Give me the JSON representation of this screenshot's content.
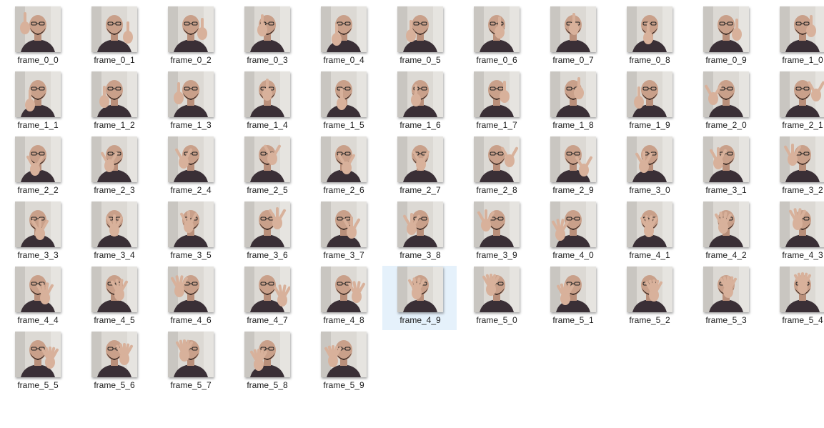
{
  "window": {
    "view": "large-icons",
    "selected_index": 49
  },
  "files": [
    {
      "name": "frame_0_0",
      "icon": "image-thumbnail-icon"
    },
    {
      "name": "frame_0_1",
      "icon": "image-thumbnail-icon"
    },
    {
      "name": "frame_0_2",
      "icon": "image-thumbnail-icon"
    },
    {
      "name": "frame_0_3",
      "icon": "image-thumbnail-icon"
    },
    {
      "name": "frame_0_4",
      "icon": "image-thumbnail-icon"
    },
    {
      "name": "frame_0_5",
      "icon": "image-thumbnail-icon"
    },
    {
      "name": "frame_0_6",
      "icon": "image-thumbnail-icon"
    },
    {
      "name": "frame_0_7",
      "icon": "image-thumbnail-icon"
    },
    {
      "name": "frame_0_8",
      "icon": "image-thumbnail-icon"
    },
    {
      "name": "frame_0_9",
      "icon": "image-thumbnail-icon"
    },
    {
      "name": "frame_1_0",
      "icon": "image-thumbnail-icon"
    },
    {
      "name": "frame_1_1",
      "icon": "image-thumbnail-icon"
    },
    {
      "name": "frame_1_2",
      "icon": "image-thumbnail-icon"
    },
    {
      "name": "frame_1_3",
      "icon": "image-thumbnail-icon"
    },
    {
      "name": "frame_1_4",
      "icon": "image-thumbnail-icon"
    },
    {
      "name": "frame_1_5",
      "icon": "image-thumbnail-icon"
    },
    {
      "name": "frame_1_6",
      "icon": "image-thumbnail-icon"
    },
    {
      "name": "frame_1_7",
      "icon": "image-thumbnail-icon"
    },
    {
      "name": "frame_1_8",
      "icon": "image-thumbnail-icon"
    },
    {
      "name": "frame_1_9",
      "icon": "image-thumbnail-icon"
    },
    {
      "name": "frame_2_0",
      "icon": "image-thumbnail-icon"
    },
    {
      "name": "frame_2_1",
      "icon": "image-thumbnail-icon"
    },
    {
      "name": "frame_2_2",
      "icon": "image-thumbnail-icon"
    },
    {
      "name": "frame_2_3",
      "icon": "image-thumbnail-icon"
    },
    {
      "name": "frame_2_4",
      "icon": "image-thumbnail-icon"
    },
    {
      "name": "frame_2_5",
      "icon": "image-thumbnail-icon"
    },
    {
      "name": "frame_2_6",
      "icon": "image-thumbnail-icon"
    },
    {
      "name": "frame_2_7",
      "icon": "image-thumbnail-icon"
    },
    {
      "name": "frame_2_8",
      "icon": "image-thumbnail-icon"
    },
    {
      "name": "frame_2_9",
      "icon": "image-thumbnail-icon"
    },
    {
      "name": "frame_3_0",
      "icon": "image-thumbnail-icon"
    },
    {
      "name": "frame_3_1",
      "icon": "image-thumbnail-icon"
    },
    {
      "name": "frame_3_2",
      "icon": "image-thumbnail-icon"
    },
    {
      "name": "frame_3_3",
      "icon": "image-thumbnail-icon"
    },
    {
      "name": "frame_3_4",
      "icon": "image-thumbnail-icon"
    },
    {
      "name": "frame_3_5",
      "icon": "image-thumbnail-icon"
    },
    {
      "name": "frame_3_6",
      "icon": "image-thumbnail-icon"
    },
    {
      "name": "frame_3_7",
      "icon": "image-thumbnail-icon"
    },
    {
      "name": "frame_3_8",
      "icon": "image-thumbnail-icon"
    },
    {
      "name": "frame_3_9",
      "icon": "image-thumbnail-icon"
    },
    {
      "name": "frame_4_0",
      "icon": "image-thumbnail-icon"
    },
    {
      "name": "frame_4_1",
      "icon": "image-thumbnail-icon"
    },
    {
      "name": "frame_4_2",
      "icon": "image-thumbnail-icon"
    },
    {
      "name": "frame_4_3",
      "icon": "image-thumbnail-icon"
    },
    {
      "name": "frame_4_4",
      "icon": "image-thumbnail-icon"
    },
    {
      "name": "frame_4_5",
      "icon": "image-thumbnail-icon"
    },
    {
      "name": "frame_4_6",
      "icon": "image-thumbnail-icon"
    },
    {
      "name": "frame_4_7",
      "icon": "image-thumbnail-icon"
    },
    {
      "name": "frame_4_8",
      "icon": "image-thumbnail-icon"
    },
    {
      "name": "frame_4_9",
      "icon": "image-thumbnail-icon"
    },
    {
      "name": "frame_5_0",
      "icon": "image-thumbnail-icon"
    },
    {
      "name": "frame_5_1",
      "icon": "image-thumbnail-icon"
    },
    {
      "name": "frame_5_2",
      "icon": "image-thumbnail-icon"
    },
    {
      "name": "frame_5_3",
      "icon": "image-thumbnail-icon"
    },
    {
      "name": "frame_5_4",
      "icon": "image-thumbnail-icon"
    },
    {
      "name": "frame_5_5",
      "icon": "image-thumbnail-icon"
    },
    {
      "name": "frame_5_6",
      "icon": "image-thumbnail-icon"
    },
    {
      "name": "frame_5_7",
      "icon": "image-thumbnail-icon"
    },
    {
      "name": "frame_5_8",
      "icon": "image-thumbnail-icon"
    },
    {
      "name": "frame_5_9",
      "icon": "image-thumbnail-icon"
    }
  ],
  "colors": {
    "selection_bg": "#e5f1fb",
    "label_text": "#1a1a1a",
    "wall": "#d9d6d1",
    "skin": "#c9a08a",
    "shirt": "#3a2f36"
  }
}
